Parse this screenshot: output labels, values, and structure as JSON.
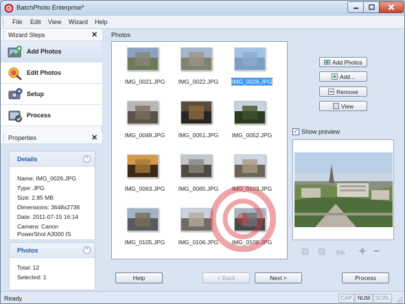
{
  "window": {
    "title": "BatchPhoto Enterprise*"
  },
  "menu": [
    "File",
    "Edit",
    "View",
    "Wizard",
    "Help"
  ],
  "wizard": {
    "title": "Wizard Steps",
    "steps": [
      {
        "label": "Add Photos",
        "icon": "add-photos-icon",
        "active": true
      },
      {
        "label": "Edit Photos",
        "icon": "edit-photos-icon",
        "active": false
      },
      {
        "label": "Setup",
        "icon": "setup-icon",
        "active": false
      },
      {
        "label": "Process",
        "icon": "process-icon",
        "active": false
      }
    ]
  },
  "properties": {
    "title": "Properties",
    "details": {
      "title": "Details",
      "name": "Name: IMG_0026.JPG",
      "type": "Type: JPG",
      "size": "Size: 2.85 MB",
      "dimensions": "Dimensions: 3648x2736",
      "date": "Date: 2011-07-15 16:14",
      "camera_line1": "Camera: Canon",
      "camera_line2": "PowerShot A3000 IS"
    },
    "photos": {
      "title": "Photos",
      "total": "Total: 12",
      "selected": "Selected: 1"
    }
  },
  "photos_panel": {
    "label": "Photos",
    "items": [
      {
        "name": "IMG_0021.JPG",
        "selected": false,
        "colors": [
          "#8aa3c2",
          "#6d7a55",
          "#8a8478"
        ]
      },
      {
        "name": "IMG_0022.JPG",
        "selected": false,
        "colors": [
          "#a3b6cc",
          "#7e8470",
          "#9c9486"
        ]
      },
      {
        "name": "IMG_0026.JPG",
        "selected": true,
        "colors": [
          "#7fb0e0",
          "#4f7fb4",
          "#6a8db6"
        ]
      },
      {
        "name": "IMG_0049.JPG",
        "selected": false,
        "colors": [
          "#b7b7b2",
          "#5b5249",
          "#7a6e60"
        ]
      },
      {
        "name": "IMG_0051.JPG",
        "selected": false,
        "colors": [
          "#5b4c3c",
          "#2b2520",
          "#8e6b40"
        ]
      },
      {
        "name": "IMG_0052.JPG",
        "selected": false,
        "colors": [
          "#c6d2e0",
          "#2c3a22",
          "#3e5230"
        ]
      },
      {
        "name": "IMG_0063.JPG",
        "selected": false,
        "colors": [
          "#d39a4a",
          "#3a2a16",
          "#a6783a"
        ]
      },
      {
        "name": "IMG_0065.JPG",
        "selected": false,
        "colors": [
          "#c2c7cc",
          "#4e4a44",
          "#8a8680"
        ]
      },
      {
        "name": "IMG_0103.JPG",
        "selected": false,
        "colors": [
          "#cfd8e2",
          "#6c6458",
          "#a79a86"
        ]
      },
      {
        "name": "IMG_0105.JPG",
        "selected": false,
        "colors": [
          "#9fb3c7",
          "#585a5c",
          "#7a6a5a"
        ]
      },
      {
        "name": "IMG_0106.JPG",
        "selected": false,
        "colors": [
          "#c8d3de",
          "#6f6b66",
          "#b4aa9c"
        ]
      },
      {
        "name": "IMG_0108.JPG",
        "selected": false,
        "colors": [
          "#a5b2bf",
          "#494949",
          "#6e7074"
        ]
      }
    ]
  },
  "buttons": {
    "add_photos": "Add Photos",
    "add": "Add...",
    "remove": "Remove",
    "view": "View",
    "help": "Help",
    "back": "< Back",
    "next": "Next >",
    "process": "Process"
  },
  "preview": {
    "label": "Show preview",
    "checked": true,
    "zoom": "5%"
  },
  "status": {
    "text": "Ready",
    "cap": "CAP",
    "num": "NUM",
    "scrl": "SCRL"
  },
  "colors": {
    "accent": "#3399ff",
    "card_title": "#1f5aa7",
    "watermark": "#d9363e"
  }
}
